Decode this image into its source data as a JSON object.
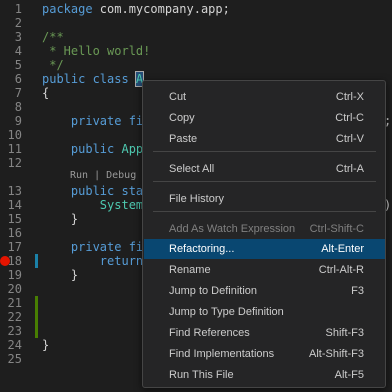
{
  "editor": {
    "lines": [
      {
        "n": "1",
        "tokens": [
          {
            "t": "package ",
            "c": "kw"
          },
          {
            "t": "com.mycompany.app;",
            "c": "pk"
          }
        ]
      },
      {
        "n": "2",
        "tokens": []
      },
      {
        "n": "3",
        "tokens": [
          {
            "t": "/**",
            "c": "cm"
          }
        ]
      },
      {
        "n": "4",
        "tokens": [
          {
            "t": " * Hello world!",
            "c": "cm"
          }
        ]
      },
      {
        "n": "5",
        "tokens": [
          {
            "t": " */",
            "c": "cm"
          }
        ]
      },
      {
        "n": "6",
        "tokens": [
          {
            "t": "public class ",
            "c": "kw"
          },
          {
            "t": "A",
            "c": "ty"
          }
        ]
      },
      {
        "n": "7",
        "tokens": [
          {
            "t": "{",
            "c": "pk"
          }
        ]
      },
      {
        "n": "8",
        "tokens": []
      },
      {
        "n": "9",
        "tokens": [
          {
            "t": "    private fi",
            "c": "kw"
          }
        ]
      },
      {
        "n": "10",
        "tokens": []
      },
      {
        "n": "11",
        "tokens": [
          {
            "t": "    public ",
            "c": "kw"
          },
          {
            "t": "App",
            "c": "ty"
          }
        ]
      },
      {
        "n": "12",
        "tokens": []
      },
      {
        "n": "13",
        "tokens": [
          {
            "t": "    public sta",
            "c": "kw"
          }
        ]
      },
      {
        "n": "14",
        "tokens": [
          {
            "t": "        System",
            "c": "ty"
          }
        ]
      },
      {
        "n": "15",
        "tokens": [
          {
            "t": "    }",
            "c": "pk"
          }
        ]
      },
      {
        "n": "16",
        "tokens": []
      },
      {
        "n": "17",
        "tokens": [
          {
            "t": "    private fi",
            "c": "kw"
          }
        ]
      },
      {
        "n": "18",
        "tokens": [
          {
            "t": "        return",
            "c": "kw"
          }
        ]
      },
      {
        "n": "19",
        "tokens": [
          {
            "t": "    }",
            "c": "pk"
          }
        ]
      },
      {
        "n": "20",
        "tokens": []
      },
      {
        "n": "21",
        "tokens": []
      },
      {
        "n": "22",
        "tokens": []
      },
      {
        "n": "23",
        "tokens": []
      },
      {
        "n": "24",
        "tokens": [
          {
            "t": "}",
            "c": "pk"
          }
        ]
      },
      {
        "n": "25",
        "tokens": []
      }
    ],
    "codelens": "Run | Debug",
    "right_fragments": {
      "line9": ";",
      "line14": ")"
    }
  },
  "context_menu": {
    "items": [
      {
        "label": "Cut",
        "shortcut": "Ctrl-X"
      },
      {
        "label": "Copy",
        "shortcut": "Ctrl-C"
      },
      {
        "label": "Paste",
        "shortcut": "Ctrl-V"
      },
      {
        "sep": true
      },
      {
        "label": "Select All",
        "shortcut": "Ctrl-A"
      },
      {
        "sep": true
      },
      {
        "label": "File History",
        "shortcut": ""
      },
      {
        "sep": true
      },
      {
        "label": "Add As Watch Expression",
        "shortcut": "Ctrl-Shift-C",
        "disabled": true
      },
      {
        "label": "Refactoring...",
        "shortcut": "Alt-Enter",
        "active": true
      },
      {
        "label": "Rename",
        "shortcut": "Ctrl-Alt-R"
      },
      {
        "label": "Jump to Definition",
        "shortcut": "F3"
      },
      {
        "label": "Jump to Type Definition",
        "shortcut": ""
      },
      {
        "label": "Find References",
        "shortcut": "Shift-F3"
      },
      {
        "label": "Find Implementations",
        "shortcut": "Alt-Shift-F3"
      },
      {
        "label": "Run This File",
        "shortcut": "Alt-F5"
      }
    ]
  },
  "colors": {
    "menu_bg": "#252526",
    "highlight": "#094771",
    "breakpoint": "#e51400"
  }
}
